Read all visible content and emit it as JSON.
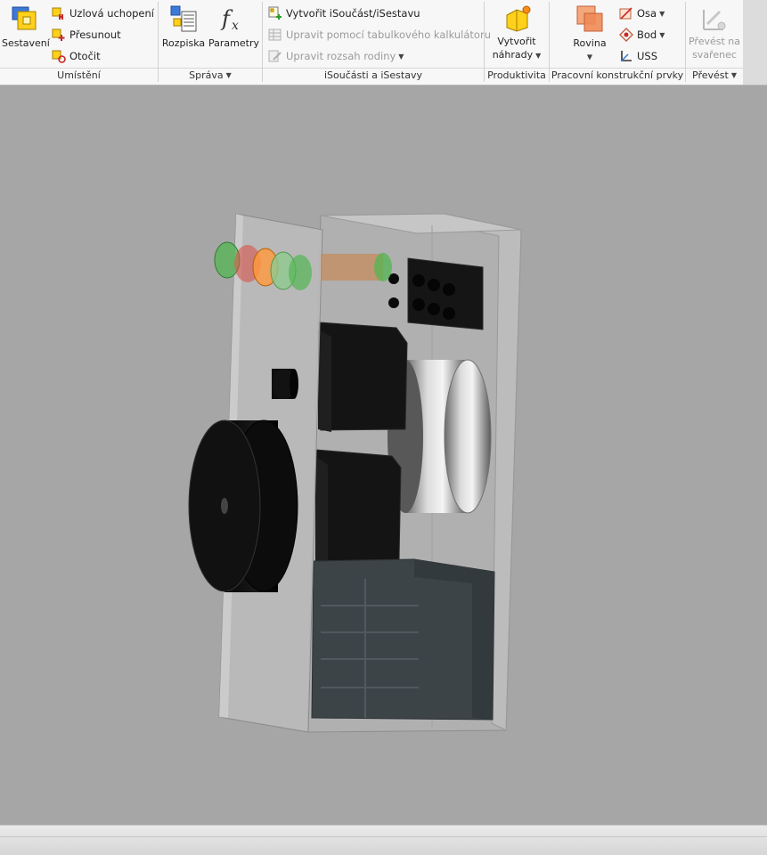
{
  "ribbon": {
    "groups": {
      "placement": {
        "label": "Umístění",
        "assembly_label": "Sestavení",
        "node_grip_label": "Uzlová uchopení",
        "move_label": "Přesunout",
        "rotate_label": "Otočit"
      },
      "manage": {
        "label": "Správa",
        "bom_label": "Rozpiska",
        "parameters_label": "Parametry"
      },
      "iparts": {
        "label": "iSoučásti a iSestavy",
        "create_label": "Vytvořit iSoučást/iSestavu",
        "edit_spreadsheet_label": "Upravit pomocí tabulkového kalkulátoru",
        "edit_family_label": "Upravit rozsah rodiny"
      },
      "productivity": {
        "label": "Produktivita",
        "create_substitute_line1": "Vytvořit",
        "create_substitute_line2": "náhrady"
      },
      "work_features": {
        "label": "Pracovní konstrukční prvky",
        "plane_label": "Rovina",
        "axis_label": "Osa",
        "point_label": "Bod",
        "ucs_label": "USS"
      },
      "convert": {
        "label": "Převést",
        "to_weldment_line1": "Převést na",
        "to_weldment_line2": "svařenec"
      }
    }
  },
  "colors": {
    "ribbon_bg": "#f7f7f7",
    "viewport_bg": "#a6a6a6",
    "disabled_text": "#9a9a9a",
    "statusbar_bg": "#dedede"
  }
}
